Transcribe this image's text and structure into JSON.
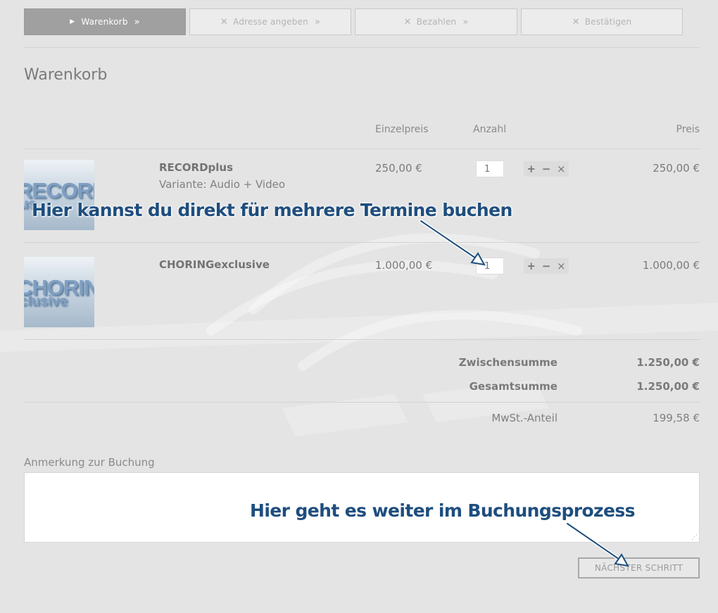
{
  "steps": [
    {
      "label": "Warenkorb",
      "icon": "play-icon",
      "active": true
    },
    {
      "label": "Adresse angeben",
      "icon": "close-icon",
      "active": false
    },
    {
      "label": "Bezahlen",
      "icon": "close-icon",
      "active": false
    },
    {
      "label": "Bestätigen",
      "icon": "close-icon",
      "active": false
    }
  ],
  "step_arrow": "»",
  "page_title": "Warenkorb",
  "columns": {
    "unit_price": "Einzelpreis",
    "quantity": "Anzahl",
    "price": "Preis"
  },
  "items": [
    {
      "thumb_text_1": "RECORD",
      "thumb_text_2": "us",
      "name": "RECORDplus",
      "variant": "Variante: Audio + Video",
      "unit_price": "250,00 €",
      "quantity": "1",
      "price": "250,00 €"
    },
    {
      "thumb_text_1": "CHORIN",
      "thumb_text_2": "clusive",
      "name": "CHORINGexclusive",
      "variant": "",
      "unit_price": "1.000,00 €",
      "quantity": "1",
      "price": "1.000,00 €"
    }
  ],
  "qty_buttons": {
    "plus": "+",
    "minus": "−",
    "remove": "×"
  },
  "totals": {
    "subtotal_label": "Zwischensumme",
    "subtotal_value": "1.250,00 €",
    "total_label": "Gesamtsumme",
    "total_value": "1.250,00 €",
    "vat_label": "MwSt.-Anteil",
    "vat_value": "199,58 €"
  },
  "note": {
    "label": "Anmerkung zur Buchung",
    "value": ""
  },
  "next_button": "NÄCHSTER SCHRITT",
  "annotations": {
    "multi_booking": "Hier kannst du direkt für mehrere Termine buchen",
    "next_step": "Hier geht es weiter im Buchungsprozess"
  },
  "colors": {
    "background": "#e4e4e4",
    "active_step": "#a0a0a0",
    "annotation_text": "#1e4e7e",
    "thumb_text": "#7f9fc2"
  }
}
